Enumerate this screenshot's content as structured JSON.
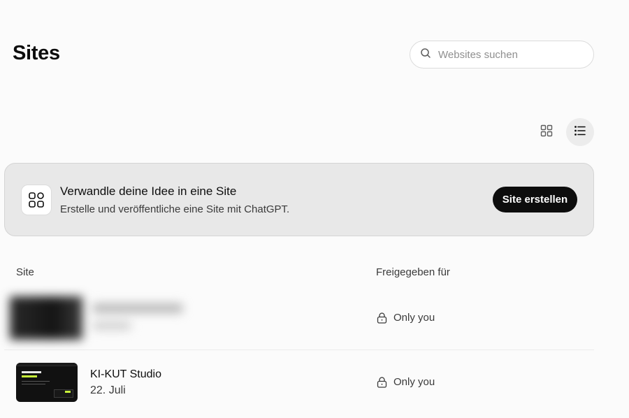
{
  "page": {
    "title": "Sites"
  },
  "search": {
    "placeholder": "Websites suchen",
    "value": ""
  },
  "view_toggle": {
    "grid_icon": "grid-view-icon",
    "list_icon": "list-view-icon",
    "active": "list"
  },
  "banner": {
    "icon": "sites-app-icon",
    "title": "Verwandle deine Idee in eine Site",
    "subtitle": "Erstelle und veröffentliche eine Site mit ChatGPT.",
    "button_label": "Site erstellen"
  },
  "table": {
    "columns": [
      "Site",
      "Freigegeben für"
    ],
    "rows": [
      {
        "name": "",
        "date": "",
        "shared_with": "Only you",
        "blurred": true
      },
      {
        "name": "KI-KUT Studio",
        "date": "22. Juli",
        "shared_with": "Only you",
        "blurred": false
      }
    ]
  },
  "colors": {
    "background": "#fbfbfb",
    "banner_bg": "#e8e8e8",
    "primary_button": "#0d0d0d",
    "thumbnail_accent": "#c7f23a"
  }
}
